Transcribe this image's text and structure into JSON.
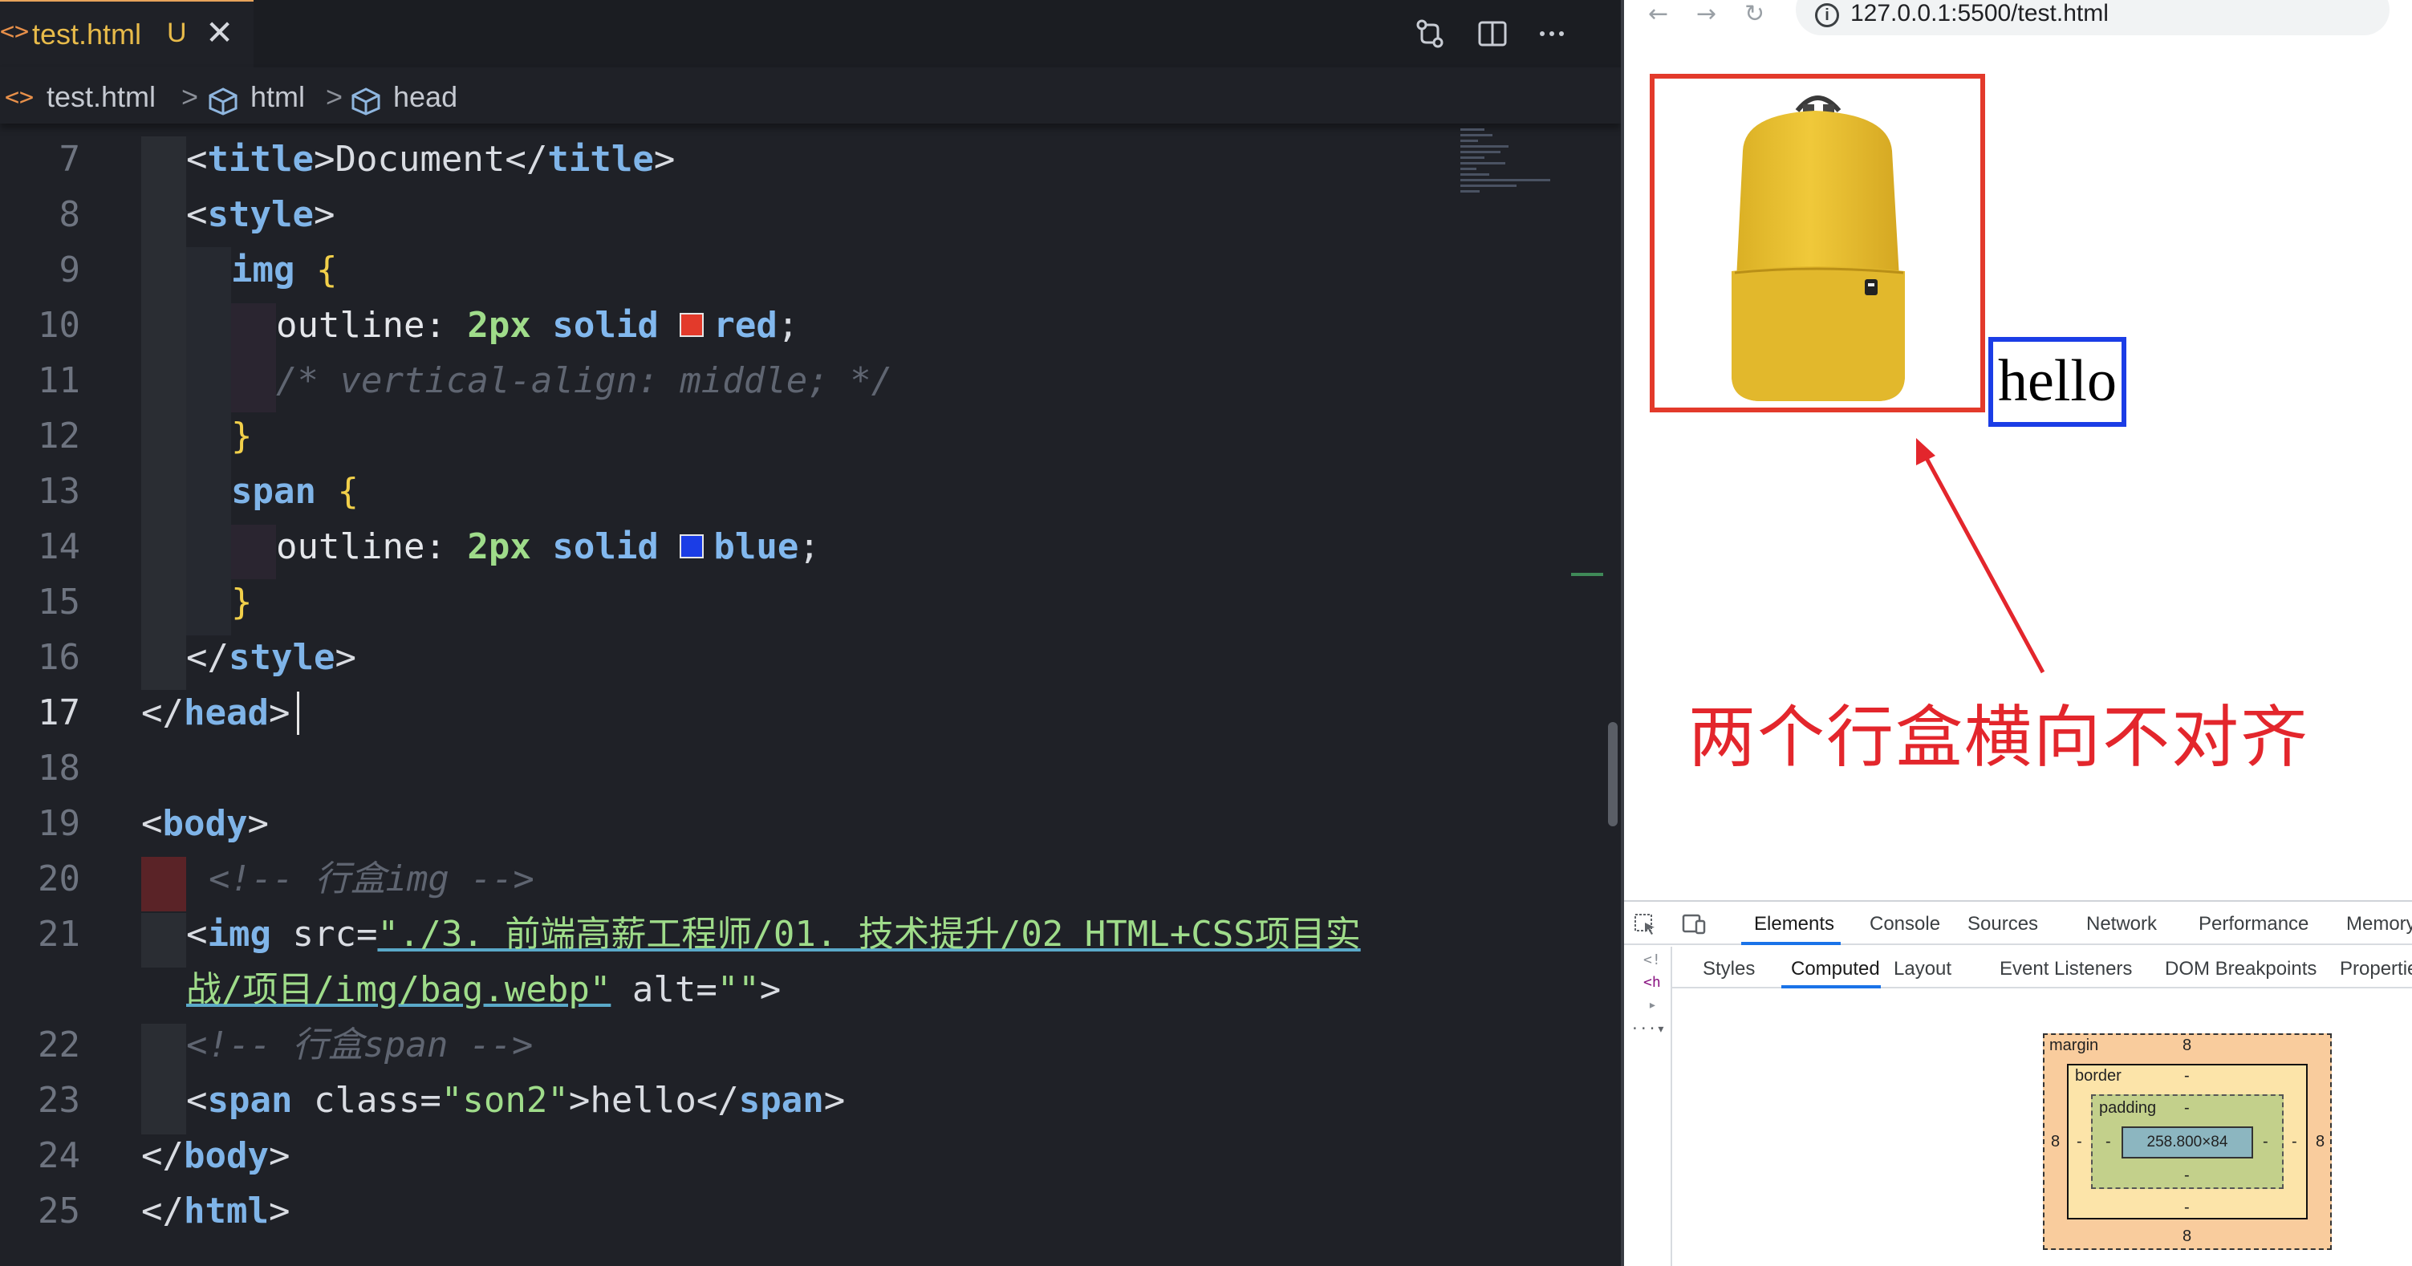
{
  "editor": {
    "tab": {
      "icon": "<>",
      "label": "test.html",
      "status": "U",
      "close": "✕"
    },
    "breadcrumb": {
      "icon": "<>",
      "file": "test.html",
      "sep": ">",
      "html": "html",
      "head": "head"
    },
    "lines": [
      {
        "n": "7",
        "text": "<title>Document</title>"
      },
      {
        "n": "8",
        "text": "<style>"
      },
      {
        "n": "9",
        "text": "img {"
      },
      {
        "n": "10",
        "text": "outline: 2px solid red;"
      },
      {
        "n": "11",
        "text": "/* vertical-align: middle; */"
      },
      {
        "n": "12",
        "text": "}"
      },
      {
        "n": "13",
        "text": "span {"
      },
      {
        "n": "14",
        "text": "outline: 2px solid blue;"
      },
      {
        "n": "15",
        "text": "}"
      },
      {
        "n": "16",
        "text": "</style>"
      },
      {
        "n": "17",
        "text": "</head>"
      },
      {
        "n": "18",
        "text": ""
      },
      {
        "n": "19",
        "text": "<body>"
      },
      {
        "n": "20",
        "text": "<!-- 行盒img -->"
      },
      {
        "n": "21",
        "text": "<img src=\"./3. 前端高薪工程师/01. 技术提升/02 HTML+CSS项目实战/项目/img/bag.webp\" alt=\"\">"
      },
      {
        "n": "22",
        "text": "<!-- 行盒span -->"
      },
      {
        "n": "23",
        "text": "<span class=\"son2\">hello</span>"
      },
      {
        "n": "24",
        "text": "</body>"
      },
      {
        "n": "25",
        "text": "</html>"
      }
    ],
    "tokens": {
      "title_open": "<",
      "title_tag": "title",
      "title_close": ">",
      "doc": "Document",
      "title_end_open": "</",
      "title_end_close": ">",
      "style_tag": "style",
      "img_sel": "img",
      "lbrace": "{",
      "rbrace": "}",
      "outline": "outline:",
      "two_px": "2px",
      "solid": "solid",
      "red": "red",
      "blue": "blue",
      "semi": ";",
      "cmt_va": "/* vertical-align: middle; */",
      "span_sel": "span",
      "head_tag": "head",
      "body_tag": "body",
      "html_tag": "html",
      "cmt_img": "<!-- 行盒img -->",
      "img_tag": "img",
      "src_attr": " src=",
      "src_val_1": "\"./3. 前端高薪工程师/01. 技术提升/02 HTML+CSS项目实",
      "src_val_2": "战/项目/img/bag.webp\"",
      "alt_attr": " alt=",
      "alt_val": "\"\"",
      "cmt_span": "<!-- 行盒span -->",
      "class_attr": " class=",
      "class_val": "\"son2\"",
      "hello": "hello"
    },
    "colors": {
      "red_swatch": "#e33a2b",
      "blue_swatch": "#1b3de6"
    }
  },
  "browser": {
    "nav": {
      "back": "←",
      "forward": "→",
      "reload": "↻"
    },
    "url": "127.0.0.1:5500/test.html",
    "page": {
      "hello": "hello",
      "annotation": "两个行盒横向不对齐"
    },
    "devtools": {
      "tabs": [
        "Elements",
        "Console",
        "Sources",
        "Network",
        "Performance",
        "Memory"
      ],
      "active_tab": "Elements",
      "subtabs": [
        "Styles",
        "Computed",
        "Layout",
        "Event Listeners",
        "DOM Breakpoints",
        "Properties"
      ],
      "active_subtab": "Computed",
      "left_lines": [
        "<!",
        "<h",
        "▸",
        "···▾"
      ],
      "boxmodel": {
        "margin_label": "margin",
        "margin_top": "8",
        "margin_left": "8",
        "margin_right": "8",
        "margin_bottom": "8",
        "border_label": "border",
        "border_top": "-",
        "border_left": "-",
        "border_right": "-",
        "border_bottom": "-",
        "padding_label": "padding",
        "padding_top": "-",
        "padding_left": "-",
        "padding_right": "-",
        "padding_bottom": "-",
        "content": "258.800×84"
      }
    }
  }
}
